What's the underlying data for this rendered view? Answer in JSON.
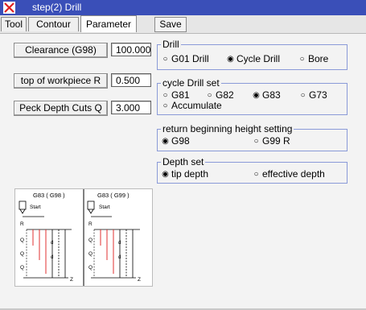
{
  "window": {
    "title": "step(2) Drill"
  },
  "tabs": [
    "Tool",
    "Contour",
    "Parameter"
  ],
  "save_label": "Save",
  "params": [
    {
      "label": "Clearance (G98)",
      "value": "100.000"
    },
    {
      "label": "top of workpiece R",
      "value": "0.500"
    },
    {
      "label": "Peck Depth Cuts Q",
      "value": "3.000"
    }
  ],
  "groups": {
    "drill": {
      "legend": "Drill",
      "options": [
        "G01 Drill",
        "Cycle Drill",
        "Bore"
      ],
      "selected": "Cycle Drill"
    },
    "cycle": {
      "legend": "cycle Drill set",
      "options": [
        "G81",
        "G82",
        "G83",
        "G73",
        "Accumulate"
      ],
      "selected": "G83"
    },
    "return": {
      "legend": "return beginning height setting",
      "options": [
        "G98",
        "G99 R"
      ],
      "selected": "G98"
    },
    "depth": {
      "legend": "Depth set",
      "options": [
        "tip depth",
        "effective depth"
      ],
      "selected": "tip depth"
    }
  },
  "diagram": {
    "left_title": "G83 ( G98 )",
    "right_title": "G83 ( G99 )",
    "start_label": "Start",
    "r_label": "R",
    "q_label": "Q",
    "d_label": "d",
    "z_label": "Z"
  }
}
